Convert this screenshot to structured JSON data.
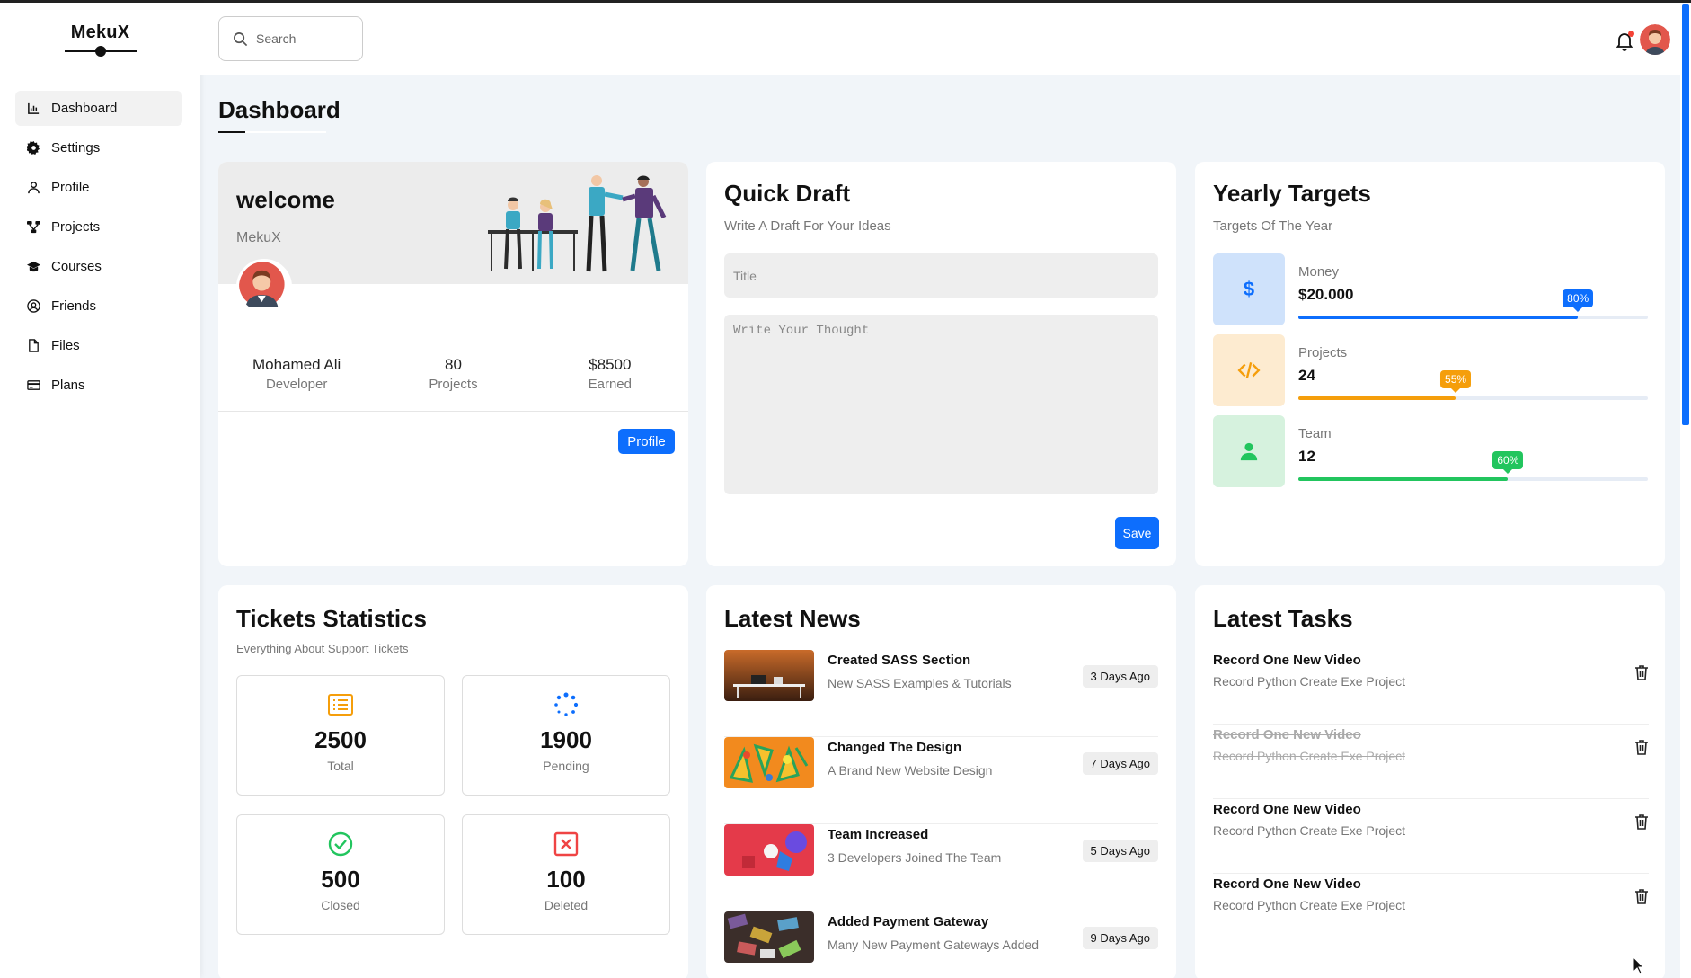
{
  "sidebar": {
    "logo": "MekuX",
    "items": [
      {
        "label": "Dashboard",
        "icon": "chart-icon"
      },
      {
        "label": "Settings",
        "icon": "gear-icon"
      },
      {
        "label": "Profile",
        "icon": "user-icon"
      },
      {
        "label": "Projects",
        "icon": "diagram-icon"
      },
      {
        "label": "Courses",
        "icon": "graduation-cap-icon"
      },
      {
        "label": "Friends",
        "icon": "user-circle-icon"
      },
      {
        "label": "Files",
        "icon": "file-icon"
      },
      {
        "label": "Plans",
        "icon": "credit-card-icon"
      }
    ],
    "active": "Dashboard"
  },
  "header": {
    "search_placeholder": "Search"
  },
  "page": {
    "title": "Dashboard"
  },
  "welcome": {
    "title": "welcome",
    "subtitle": "MekuX",
    "stats": [
      {
        "value": "Mohamed Ali",
        "label": "Developer"
      },
      {
        "value": "80",
        "label": "Projects"
      },
      {
        "value": "$8500",
        "label": "Earned"
      }
    ],
    "button": "Profile"
  },
  "quick_draft": {
    "title": "Quick Draft",
    "subtitle": "Write A Draft For Your Ideas",
    "title_placeholder": "Title",
    "body_placeholder": "Write Your Thought",
    "button": "Save"
  },
  "yearly_targets": {
    "title": "Yearly Targets",
    "subtitle": "Targets Of The Year",
    "items": [
      {
        "label": "Money",
        "value": "$20.000",
        "percent": 80,
        "percent_label": "80%",
        "icon": "dollar-icon",
        "color": "#0d6efd",
        "bg": "#cfe2fb"
      },
      {
        "label": "Projects",
        "value": "24",
        "percent": 45,
        "percent_label": "55%",
        "icon": "code-icon",
        "color": "#f59e0b",
        "bg": "#fdebd0"
      },
      {
        "label": "Team",
        "value": "12",
        "percent": 60,
        "percent_label": "60%",
        "icon": "user-icon",
        "color": "#22c55e",
        "bg": "#d6f2de"
      }
    ]
  },
  "tickets": {
    "title": "Tickets Statistics",
    "subtitle": "Everything About Support Tickets",
    "items": [
      {
        "value": "2500",
        "label": "Total",
        "icon": "list-icon",
        "color": "#f59e0b"
      },
      {
        "value": "1900",
        "label": "Pending",
        "icon": "spinner-icon",
        "color": "#0d6efd"
      },
      {
        "value": "500",
        "label": "Closed",
        "icon": "check-circle-icon",
        "color": "#22c55e"
      },
      {
        "value": "100",
        "label": "Deleted",
        "icon": "x-square-icon",
        "color": "#ef4444"
      }
    ]
  },
  "news": {
    "title": "Latest News",
    "items": [
      {
        "title": "Created SASS Section",
        "desc": "New SASS Examples & Tutorials",
        "time": "3 Days Ago"
      },
      {
        "title": "Changed The Design",
        "desc": "A Brand New Website Design",
        "time": "7 Days Ago"
      },
      {
        "title": "Team Increased",
        "desc": "3 Developers Joined The Team",
        "time": "5 Days Ago"
      },
      {
        "title": "Added Payment Gateway",
        "desc": "Many New Payment Gateways Added",
        "time": "9 Days Ago"
      }
    ]
  },
  "tasks": {
    "title": "Latest Tasks",
    "items": [
      {
        "title": "Record One New Video",
        "desc": "Record Python Create Exe Project",
        "done": false
      },
      {
        "title": "Record One New Video",
        "desc": "Record Python Create Exe Project",
        "done": true
      },
      {
        "title": "Record One New Video",
        "desc": "Record Python Create Exe Project",
        "done": false
      },
      {
        "title": "Record One New Video",
        "desc": "Record Python Create Exe Project",
        "done": false
      }
    ]
  }
}
